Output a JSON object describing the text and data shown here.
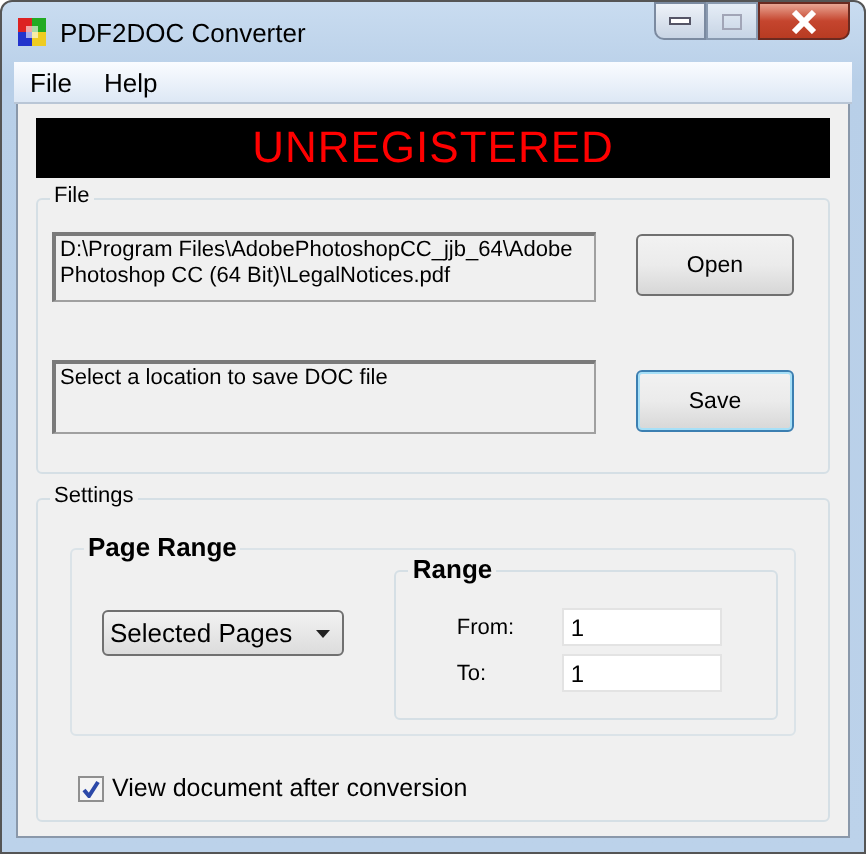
{
  "window": {
    "title": "PDF2DOC Converter"
  },
  "menu": [
    "File",
    "Help"
  ],
  "banner": "UNREGISTERED",
  "file_group": {
    "label": "File",
    "source": {
      "value": "D:\\Program Files\\AdobePhotoshopCC_jjb_64\\Adobe Photoshop CC (64 Bit)\\LegalNotices.pdf",
      "button": "Open",
      "focused": false
    },
    "target": {
      "value": "Select a location to save DOC file",
      "button": "Save",
      "focused": true
    }
  },
  "settings": {
    "label": "Settings",
    "page_range": {
      "label": "Page Range",
      "dropdown": "Selected Pages"
    },
    "range": {
      "label": "Range",
      "fields": [
        {
          "label": "From:",
          "value": "1"
        },
        {
          "label": "To:",
          "value": "1"
        }
      ]
    },
    "view_after": {
      "label": "View document after conversion",
      "checked": true
    }
  }
}
